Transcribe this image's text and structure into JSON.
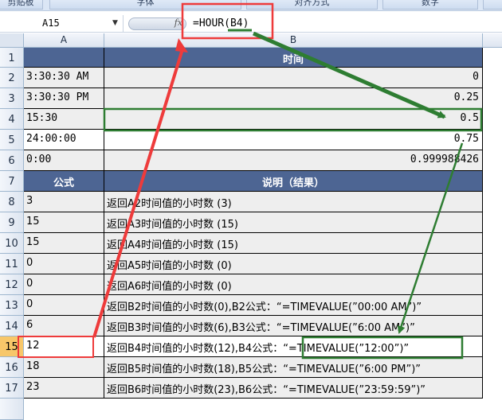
{
  "ribbon": {
    "groups": [
      "剪贴板",
      "字体",
      "对齐方式",
      "数字"
    ]
  },
  "formula_bar": {
    "name_box": "A15",
    "fx_symbol": "fx",
    "formula": "=HOUR(B4)"
  },
  "columns": [
    "A",
    "B"
  ],
  "rows": [
    {
      "num": "1",
      "a": "",
      "b": "时间",
      "header": true
    },
    {
      "num": "2",
      "a": "3:30:30 AM",
      "b": "0"
    },
    {
      "num": "3",
      "a": "3:30:30 PM",
      "b": "0.25"
    },
    {
      "num": "4",
      "a": "15:30",
      "b": "0.5"
    },
    {
      "num": "5",
      "a": "24:00:00",
      "b": "0.75"
    },
    {
      "num": "6",
      "a": "0:00",
      "b": "0.999988426"
    },
    {
      "num": "7",
      "a": "公式",
      "b": "说明（结果）",
      "header": true
    },
    {
      "num": "8",
      "a": "3",
      "b": "返回A2时间值的小时数 (3)"
    },
    {
      "num": "9",
      "a": "15",
      "b": "返回A3时间值的小时数 (15)"
    },
    {
      "num": "10",
      "a": "15",
      "b": "返回A4时间值的小时数 (15)"
    },
    {
      "num": "11",
      "a": "0",
      "b": "返回A5时间值的小时数 (0)"
    },
    {
      "num": "12",
      "a": "0",
      "b": "返回A6时间值的小时数 (0)"
    },
    {
      "num": "13",
      "a": "0",
      "b": "返回B2时间值的小时数(0),B2公式：“=TIMEVALUE(”00:00 AM”)”"
    },
    {
      "num": "14",
      "a": "6",
      "b": "返回B3时间值的小时数(6),B3公式：“=TIMEVALUE(”6:00 AM”)”"
    },
    {
      "num": "15",
      "a": "12",
      "b": "返回B4时间值的小时数(12),B4公式：“=TIMEVALUE(”12:00”)”"
    },
    {
      "num": "16",
      "a": "18",
      "b": "返回B5时间值的小时数(18),B5公式：“=TIMEVALUE(”6:00 PM”)”"
    },
    {
      "num": "17",
      "a": "23",
      "b": "返回B6时间值的小时数(23),B6公式：“=TIMEVALUE(”23:59:59”)”"
    }
  ],
  "annotation_colors": {
    "red": "#ee3b3b",
    "green": "#2e7d32"
  }
}
